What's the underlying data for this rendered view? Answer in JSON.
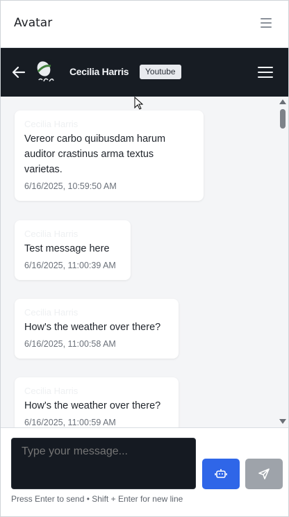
{
  "app": {
    "title": "Avatar",
    "menu_icon": "menu-icon"
  },
  "chat_header": {
    "back_icon": "arrow-left-icon",
    "avatar_icon": "avatar-image",
    "contact_name": "Cecilia Harris",
    "platform_badge": "Youtube",
    "menu_icon": "hamburger-icon",
    "colors": {
      "background": "#171c23",
      "text": "#f2f4f7",
      "badge_bg": "#e8eaee"
    }
  },
  "messages": [
    {
      "sender": "Cecilia Harris",
      "text": "Vereor carbo quibusdam harum auditor crastinus arma textus varietas.",
      "timestamp": "6/16/2025, 10:59:50 AM"
    },
    {
      "sender": "Cecilia Harris",
      "text": "Test message here",
      "timestamp": "6/16/2025, 11:00:39 AM"
    },
    {
      "sender": "Cecilia Harris",
      "text": "How's the weather over there?",
      "timestamp": "6/16/2025, 11:00:58 AM"
    },
    {
      "sender": "Cecilia Harris",
      "text": "How's the weather over there?",
      "timestamp": "6/16/2025, 11:00:59 AM"
    }
  ],
  "composer": {
    "placeholder": "Type your message...",
    "ai_button_icon": "robot-icon",
    "send_button_icon": "send-icon",
    "hint": "Press Enter to send • Shift + Enter for new line",
    "colors": {
      "ai_button": "#2f66e8",
      "send_button": "#9ea3aa",
      "input_bg": "#151a22"
    }
  }
}
